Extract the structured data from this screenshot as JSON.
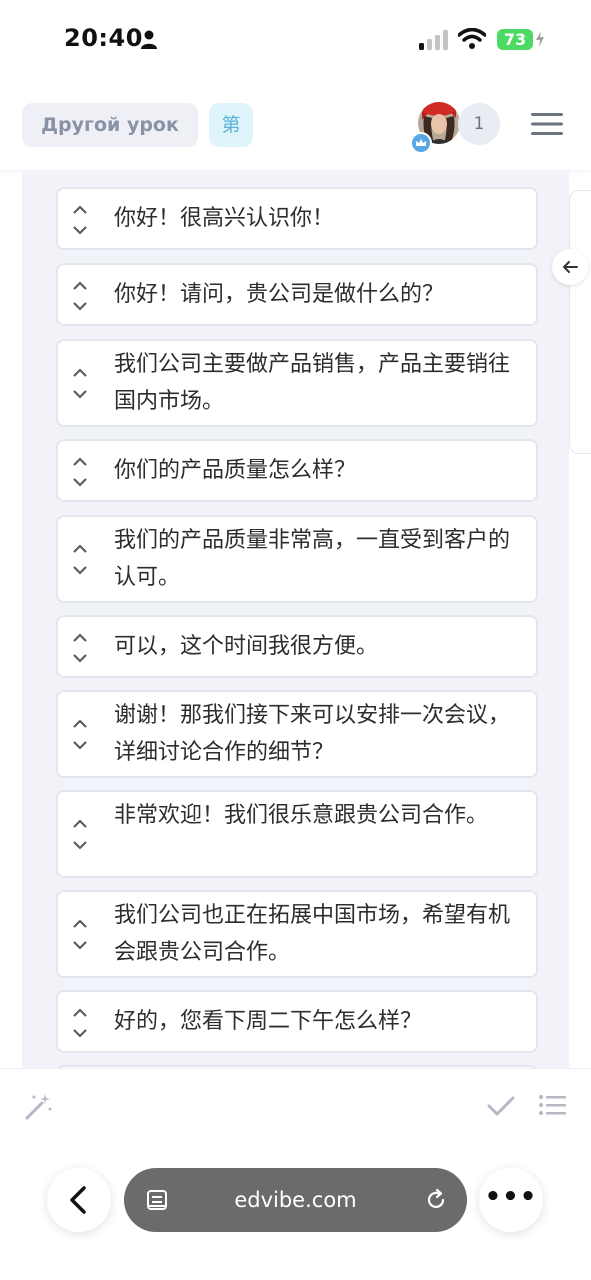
{
  "status_bar": {
    "time": "20:40",
    "battery": "73"
  },
  "header": {
    "other_lesson_label": "Другой урок",
    "lesson_chip_label": "第",
    "user_count": "1"
  },
  "dialog": {
    "items": [
      {
        "text": "你好！很高兴认识你！"
      },
      {
        "text": "你好！请问，贵公司是做什么的？"
      },
      {
        "text": "我们公司主要做产品销售，产品主要销往国内市场。"
      },
      {
        "text": "你们的产品质量怎么样？"
      },
      {
        "text": "我们的产品质量非常高，一直受到客户的认可。"
      },
      {
        "text": "可以，这个时间我很方便。"
      },
      {
        "text": "谢谢！那我们接下来可以安排一次会议，详细讨论合作的细节？"
      },
      {
        "text": "非常欢迎！我们很乐意跟贵公司合作。"
      },
      {
        "text": "我们公司也正在拓展中国市场，希望有机会跟贵公司合作。"
      },
      {
        "text": "好的，您看下周二下午怎么样？"
      }
    ]
  },
  "browser": {
    "url": "edvibe.com"
  },
  "icons": {
    "person": "person-icon",
    "signal": "cellular-signal-icon",
    "wifi": "wifi-icon",
    "menu": "hamburger-menu-icon",
    "back": "arrow-left-icon",
    "wand": "magic-wand-icon",
    "check": "checkmark-icon",
    "list": "list-icon",
    "browser_back": "chevron-left-icon",
    "page": "page-icon",
    "reload": "reload-icon",
    "more": "more-dots-icon"
  },
  "colors": {
    "battery": "#4cd964",
    "content_bg": "#f1f3f8",
    "chip_text": "#5ab4d6"
  }
}
